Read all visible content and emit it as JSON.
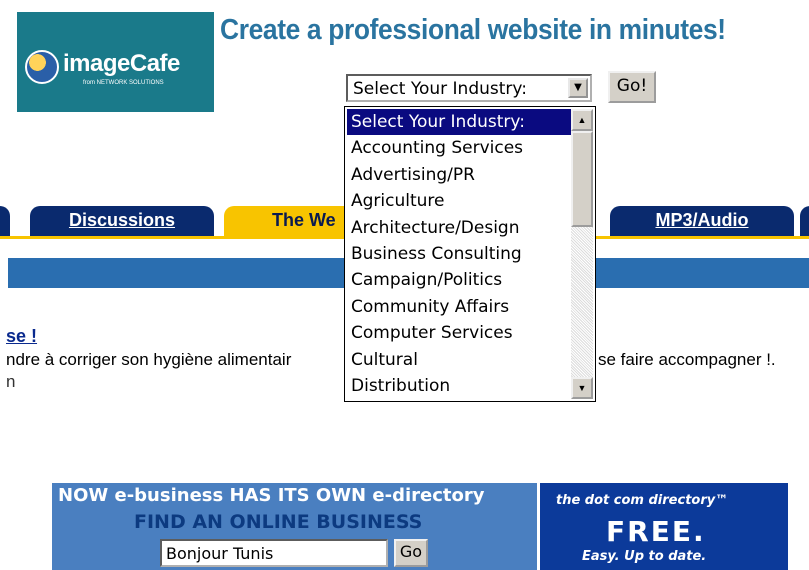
{
  "logo": {
    "name": "imageCafe",
    "subtitle": "from NETWORK SOLUTIONS"
  },
  "headline": "Create a professional website in minutes!",
  "industry_select": {
    "selected": "Select Your Industry:",
    "arrow": "▼"
  },
  "go_button": "Go!",
  "nav_tabs": [
    {
      "label": "Discussions"
    },
    {
      "label": "The We"
    },
    {
      "label": "MP3/Audio"
    }
  ],
  "article": {
    "title": "se !",
    "body_left": "ndre à corriger son hygiène alimentair",
    "body_right": "se faire accompagner !.",
    "sub": "n"
  },
  "dropdown": {
    "options": [
      "Select Your Industry:",
      "Accounting Services",
      "Advertising/PR",
      "Agriculture",
      "Architecture/Design",
      "Business Consulting",
      "Campaign/Politics",
      "Community Affairs",
      "Computer Services",
      "Cultural",
      "Distribution"
    ],
    "selected_index": 0,
    "up_arrow": "▲",
    "down_arrow": "▼"
  },
  "ad": {
    "top_line": "NOW e-business HAS ITS OWN e-directory",
    "find_line": "FIND AN ONLINE BUSINESS",
    "search_value": "Bonjour Tunis",
    "go_label": "Go",
    "dotcom": "the dot com directory™",
    "free": "FREE.",
    "easy": "Easy. Up to date."
  }
}
